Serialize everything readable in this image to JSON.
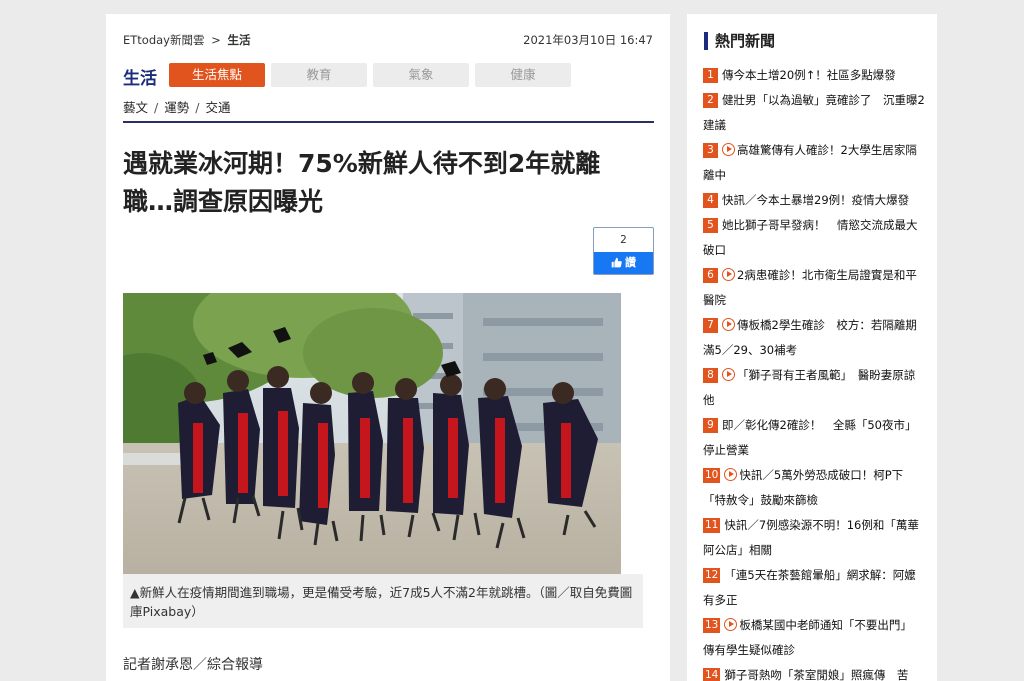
{
  "breadcrumb": {
    "site": "ETtoday新聞雲",
    "separator": ">",
    "section": "生活"
  },
  "article_date": "2021年03月10日 16:47",
  "category": {
    "title": "生活",
    "tabs": [
      {
        "label": "生活焦點",
        "active": true
      },
      {
        "label": "教育",
        "active": false
      },
      {
        "label": "氣象",
        "active": false
      },
      {
        "label": "健康",
        "active": false
      }
    ],
    "subcategories": [
      "藝文",
      "運勢",
      "交通"
    ],
    "subcategory_separator": "/"
  },
  "headline_lines": [
    "遇就業冰河期！75%新鮮人待不到2年就離",
    "職…調查原因曝光"
  ],
  "like": {
    "count": "2",
    "label": "讚"
  },
  "photo": {
    "caption": "▲新鮮人在疫情期間進到職場，更是備受考驗，近7成5人不滿2年就跳槽。（圖／取自免費圖庫Pixabay）"
  },
  "reporter": "記者謝承恩／綜合報導",
  "sidebar": {
    "title": "熱門新聞",
    "items": [
      {
        "num": "1",
        "video": false,
        "text": "傳今本土增20例↑！社區多點爆發"
      },
      {
        "num": "2",
        "video": false,
        "text": "健壯男「以為過敏」竟確診了　沉重曝2建議"
      },
      {
        "num": "3",
        "video": true,
        "text": "高雄驚傳有人確診！2大學生居家隔離中"
      },
      {
        "num": "4",
        "video": false,
        "text": "快訊／今本土暴增29例！疫情大爆發"
      },
      {
        "num": "5",
        "video": false,
        "text": "她比獅子哥早發病！　情慾交流成最大破口"
      },
      {
        "num": "6",
        "video": true,
        "text": "2病患確診！北市衛生局證實是和平醫院"
      },
      {
        "num": "7",
        "video": true,
        "text": "傳板橋2學生確診　校方：若隔離期滿5／29、30補考"
      },
      {
        "num": "8",
        "video": true,
        "text": "「獅子哥有王者風範」　醫盼妻原諒他"
      },
      {
        "num": "9",
        "video": false,
        "text": "即／彰化傳2確診！　全縣「50夜市」停止營業"
      },
      {
        "num": "10",
        "video": true,
        "text": "快訊／5萬外勞恐成破口！柯P下「特赦令」鼓勵來篩檢"
      },
      {
        "num": "11",
        "video": false,
        "text": "快訊／7例感染源不明！16例和「萬華阿公店」相關"
      },
      {
        "num": "12",
        "video": false,
        "text": "「連5天在茶藝館暈船」網求解：阿嬤有多正"
      },
      {
        "num": "13",
        "video": true,
        "text": "板橋某國中老師通知「不要出門」　傳有學生疑似確診"
      },
      {
        "num": "14",
        "video": false,
        "text": "獅子哥熱吻「茶室閒娘」照瘋傳　苦"
      }
    ]
  },
  "colors": {
    "accent": "#e2541e",
    "brand_navy": "#1d2b7c",
    "facebook_blue": "#1877f2"
  },
  "icons": {
    "like": "thumbs-up-icon",
    "video": "play-circle-icon"
  }
}
